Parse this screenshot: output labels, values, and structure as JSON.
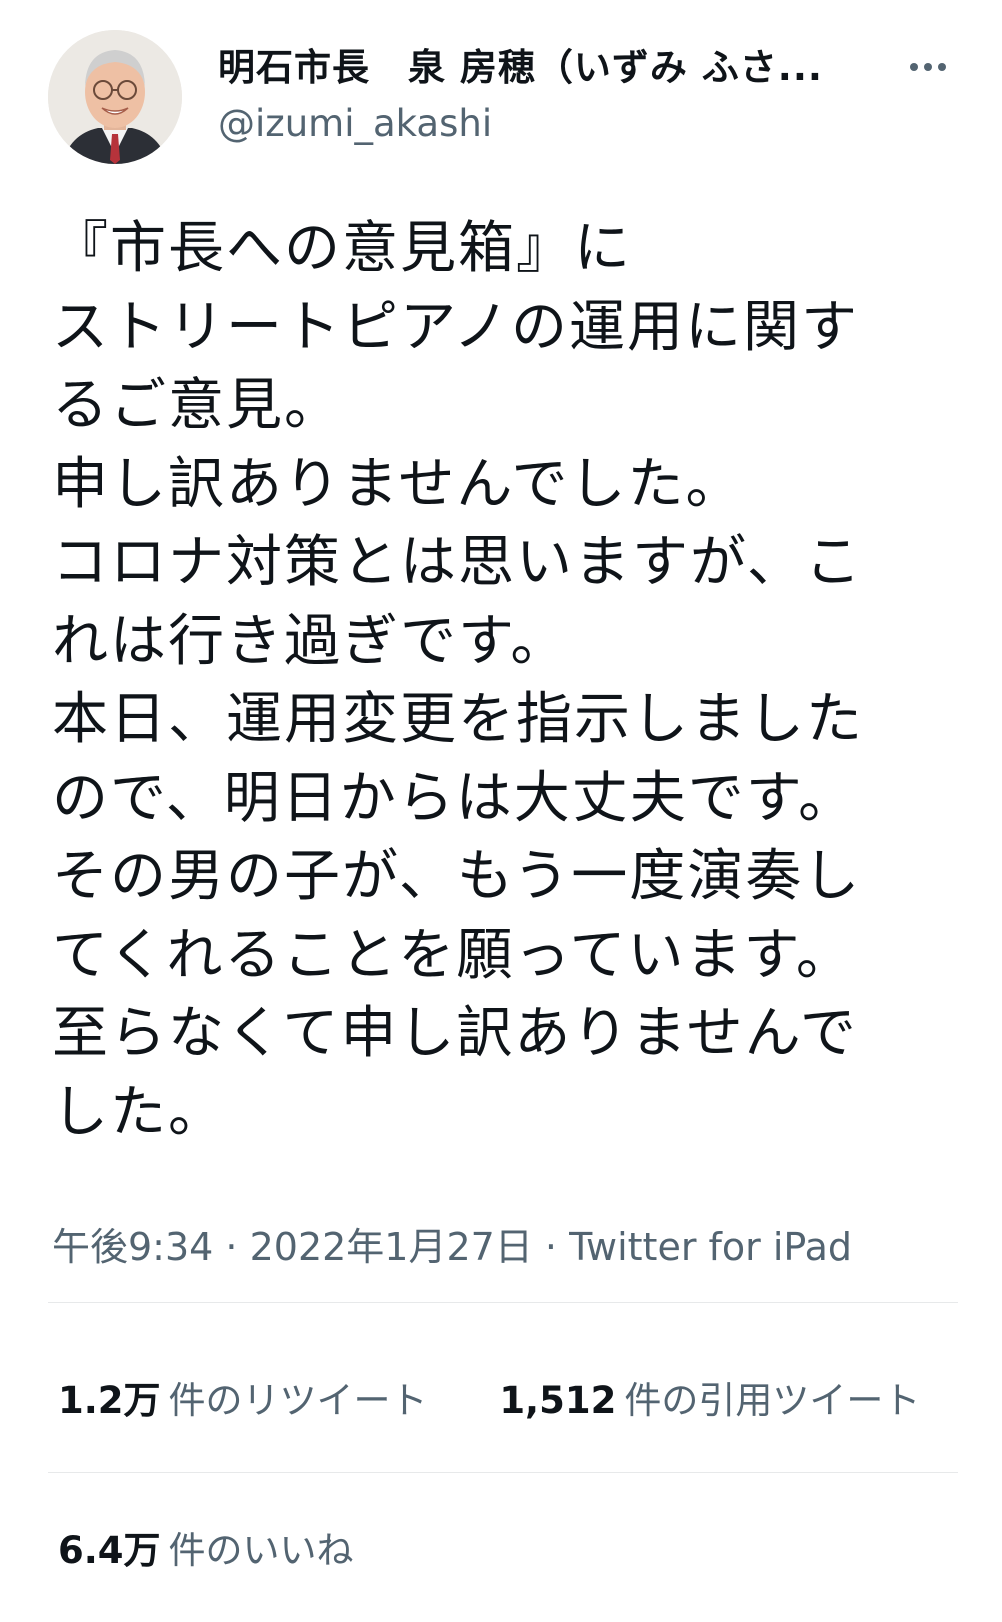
{
  "header": {
    "display_name": "明石市長　泉 房穂（いずみ ふさ...",
    "handle": "@izumi_akashi",
    "more_icon": "more-horizontal-icon"
  },
  "tweet": {
    "lines": [
      "『市長への意見箱』に",
      "ストリートピアノの運用に関す",
      "るご意見。",
      "申し訳ありませんでした。",
      "コロナ対策とは思いますが、こ",
      "れは行き過ぎです。",
      "本日、運用変更を指示しました",
      "ので、明日からは大丈夫です。",
      "その男の子が、もう一度演奏し",
      "てくれることを願っています。",
      "至らなくて申し訳ありませんで",
      "した。"
    ]
  },
  "meta": {
    "time": "午後9:34",
    "separator1": " · ",
    "date": "2022年1月27日",
    "separator2": " · ",
    "source": "Twitter for iPad"
  },
  "stats": {
    "retweets_count": "1.2万",
    "retweets_label": "件のリツイート",
    "quotes_count": "1,512",
    "quotes_label": "件の引用ツイート",
    "likes_count": "6.4万",
    "likes_label": "件のいいね"
  },
  "colors": {
    "text_primary": "#0f1419",
    "text_secondary": "#536471",
    "divider": "#e7e9ea"
  }
}
